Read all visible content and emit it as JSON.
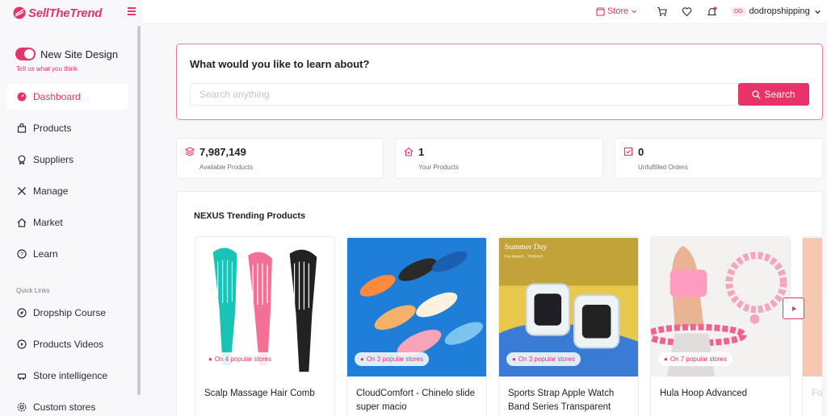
{
  "app": {
    "logo_text": "SellTheTrend"
  },
  "sidebar": {
    "toggle_label": "New Site Design",
    "tell_us": "Tell us what you think",
    "items": [
      {
        "label": "Dashboard",
        "icon": "dashboard-icon"
      },
      {
        "label": "Products",
        "icon": "bag-icon"
      },
      {
        "label": "Suppliers",
        "icon": "medal-icon"
      },
      {
        "label": "Manage",
        "icon": "tools-icon"
      },
      {
        "label": "Market",
        "icon": "house-icon"
      },
      {
        "label": "Learn",
        "icon": "help-icon"
      }
    ],
    "quick_links_label": "Quick Links",
    "quick_links": [
      {
        "label": "Dropship Course",
        "icon": "compass-icon"
      },
      {
        "label": "Products Videos",
        "icon": "play-icon"
      },
      {
        "label": "Store intelligence",
        "icon": "car-icon"
      },
      {
        "label": "Custom stores",
        "icon": "gear-icon"
      }
    ]
  },
  "topbar": {
    "store_label": "Store",
    "user_initials": "DO",
    "username": "dodropshipping"
  },
  "search": {
    "title": "What would you like to learn about?",
    "placeholder": "Search anything",
    "button_label": "Search"
  },
  "stats": [
    {
      "value": "7,987,149",
      "label": "Available Products",
      "icon": "layers-icon"
    },
    {
      "value": "1",
      "label": "Your Products",
      "icon": "home-heart-icon"
    },
    {
      "value": "0",
      "label": "Unfulfilled Orders",
      "icon": "checklist-icon"
    }
  ],
  "trending": {
    "title": "NEXUS Trending Products",
    "products": [
      {
        "name": "Scalp Massage Hair Comb",
        "badge": "On 4 popular stores"
      },
      {
        "name": "CloudComfort - Chinelo slide super macio",
        "badge": "On 3 popular stores"
      },
      {
        "name": "Sports Strap Apple Watch Band Series Transparent",
        "badge": "On 3 popular stores",
        "image_caption": "Summer Day",
        "image_subcaption": "For iWatch · 7/6/5/4/3"
      },
      {
        "name": "Hula Hoop Advanced",
        "badge": "On 7 popular stores"
      },
      {
        "name": "Fo",
        "badge": ""
      }
    ]
  },
  "colors": {
    "accent": "#e8336a",
    "background": "#f8f8fa"
  }
}
